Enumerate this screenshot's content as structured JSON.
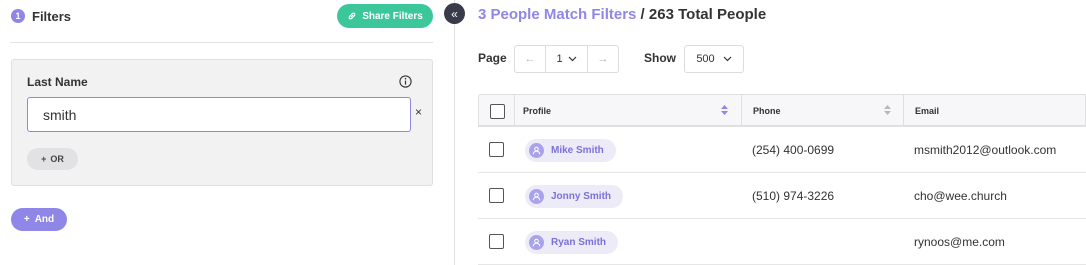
{
  "filters": {
    "step_number": "1",
    "title": "Filters",
    "share_label": "Share Filters",
    "share_icon": "link-icon",
    "card": {
      "label": "Last Name",
      "value": "smith",
      "clear_glyph": "×",
      "or_label": "OR",
      "or_glyph": "+"
    },
    "and_label": "And",
    "and_glyph": "+",
    "collapse_glyph": "«"
  },
  "results": {
    "match_text": "3 People Match Filters",
    "separator": " / ",
    "total_text": "263 Total People",
    "page_label": "Page",
    "prev_glyph": "←",
    "current_page": "1",
    "next_glyph": "→",
    "show_label": "Show",
    "show_value": "500"
  },
  "table": {
    "columns": {
      "profile": "Profile",
      "phone": "Phone",
      "email": "Email"
    },
    "rows": [
      {
        "name": "Mike Smith",
        "phone": "(254) 400-0699",
        "email": "msmith2012@outlook.com"
      },
      {
        "name": "Jonny Smith",
        "phone": "(510) 974-3226",
        "email": "cho@wee.church"
      },
      {
        "name": "Ryan Smith",
        "phone": "",
        "email": "rynoos@me.com"
      }
    ]
  },
  "colors": {
    "accent": "#8f86e8",
    "share_green": "#3cc79a",
    "collapse_dark": "#393b4a"
  }
}
